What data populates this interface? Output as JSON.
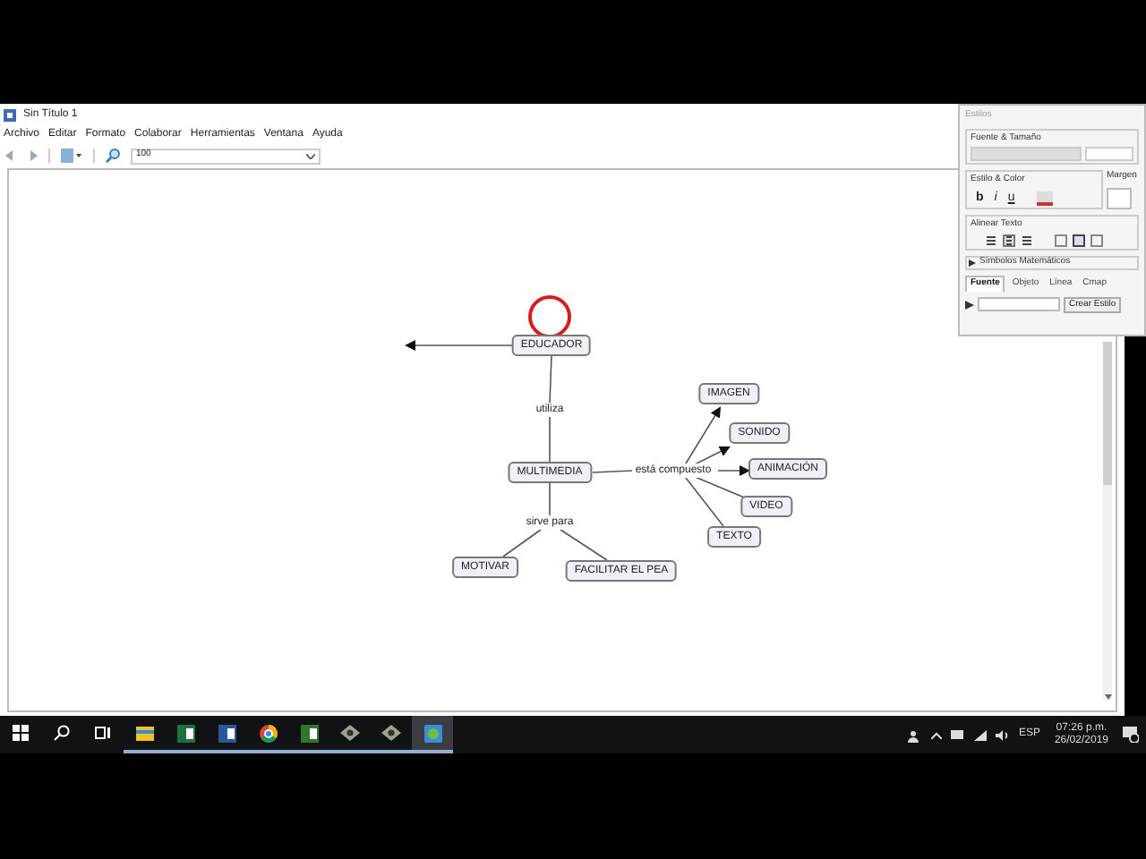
{
  "window": {
    "title": "Sin Título 1"
  },
  "menu": [
    "Archivo",
    "Editar",
    "Formato",
    "Colaborar",
    "Herramientas",
    "Ventana",
    "Ayuda"
  ],
  "toolbar": {
    "zoom": "100"
  },
  "concept_map": {
    "concepts": [
      {
        "text": "EDUCADOR"
      },
      {
        "text": "MULTIMEDIA"
      },
      {
        "text": "IMAGEN"
      },
      {
        "text": "SONIDO"
      },
      {
        "text": "ANIMACIÓN"
      },
      {
        "text": "VIDEO"
      },
      {
        "text": "TEXTO"
      },
      {
        "text": "MOTIVAR"
      },
      {
        "text": "FACILITAR EL PEA"
      }
    ],
    "link_phrases": [
      "utiliza",
      "está compuesto",
      "sirve para"
    ]
  },
  "styles_panel": {
    "title": "Estilos",
    "font_group": "Fuente & Tamaño",
    "style_group": "Estilo & Color",
    "style_buttons": [
      "b",
      "i",
      "u"
    ],
    "margin_group": "Margen",
    "align_group": "Alinear Texto",
    "h_align": [
      {
        "selected": false
      },
      {
        "selected": true
      },
      {
        "selected": false
      }
    ],
    "v_align": [
      {
        "selected": false
      },
      {
        "selected": true
      },
      {
        "selected": false
      }
    ],
    "math_symbols": "Símbolos Matemáticos",
    "tabs": [
      {
        "label": "Fuente",
        "selected": true
      },
      {
        "label": "Objeto",
        "selected": false
      },
      {
        "label": "Línea",
        "selected": false
      },
      {
        "label": "Cmap",
        "selected": false
      }
    ],
    "create_button": "Crear Estilo"
  },
  "taskbar": {
    "apps": [
      {
        "kind": "start",
        "running": false,
        "selected": false
      },
      {
        "kind": "search",
        "running": false,
        "selected": false
      },
      {
        "kind": "taskview",
        "running": false,
        "selected": false
      },
      {
        "kind": "folder",
        "running": true,
        "selected": false
      },
      {
        "kind": "excel",
        "running": true,
        "selected": false
      },
      {
        "kind": "word",
        "running": true,
        "selected": false
      },
      {
        "kind": "chrome",
        "running": true,
        "selected": false
      },
      {
        "kind": "project",
        "running": true,
        "selected": false
      },
      {
        "kind": "tool",
        "running": true,
        "selected": false
      },
      {
        "kind": "tool",
        "running": true,
        "selected": false
      },
      {
        "kind": "cmap",
        "running": true,
        "selected": true
      }
    ],
    "language": "ESP",
    "time": "07:26 p.m.",
    "date": "26/02/2019"
  }
}
